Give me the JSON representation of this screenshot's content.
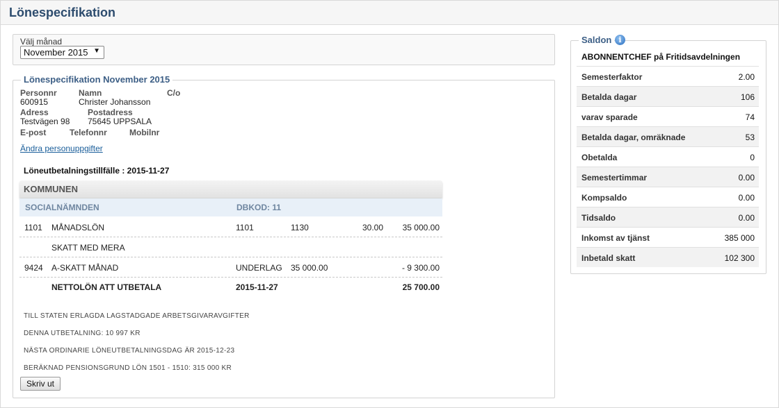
{
  "page": {
    "title": "Lönespecifikation"
  },
  "month": {
    "label": "Välj månad",
    "selected": "November 2015"
  },
  "spec": {
    "legend": "Lönespecifikation November 2015",
    "personnr_label": "Personnr",
    "personnr": "600915",
    "namn_label": "Namn",
    "namn": "Christer Johansson",
    "co_label": "C/o",
    "adress_label": "Adress",
    "adress": "Testvägen 98",
    "postadress_label": "Postadress",
    "postadress": "75645 UPPSALA",
    "epost_label": "E-post",
    "telefon_label": "Telefonnr",
    "mobil_label": "Mobilnr",
    "edit_link": "Ändra personuppgifter",
    "payout_occasion": "Löneutbetalningstillfälle : 2015-11-27",
    "employer": "KOMMUNEN",
    "department": "SOCIALNÄMNDEN",
    "dbkod": "DBKOD: 11",
    "rows": [
      {
        "code": "1101",
        "text": "MÅNADSLÖN",
        "c3": "1101",
        "c4": "1130",
        "c5": "30.00",
        "amount": "35 000.00"
      },
      {
        "code": "",
        "text": "SKATT MED MERA",
        "c3": "",
        "c4": "",
        "c5": "",
        "amount": ""
      },
      {
        "code": "9424",
        "text": "A-SKATT MÅNAD",
        "c3": "UNDERLAG",
        "c4": "35 000.00",
        "c5": "",
        "amount": "- 9 300.00"
      },
      {
        "code": "",
        "text": "NETTOLÖN ATT UTBETALA",
        "c3": "2015-11-27",
        "c4": "",
        "c5": "",
        "amount": "25 700.00"
      }
    ],
    "info": [
      "TILL STATEN ERLAGDA LAGSTADGADE ARBETSGIVARAVGIFTER",
      "DENNA UTBETALNING:  10 997 KR",
      "NÄSTA ORDINARIE LÖNEUTBETALNINGSDAG ÄR   2015-12-23",
      "BERÄKNAD PENSIONSGRUND LÖN   1501 - 1510:  315 000 KR"
    ],
    "print_button": "Skriv ut"
  },
  "saldon": {
    "legend": "Saldon",
    "info_icon": "info-icon",
    "role": "ABONNENTCHEF på Fritidsavdelningen",
    "items": [
      {
        "label": "Semesterfaktor",
        "value": "2.00"
      },
      {
        "label": "Betalda dagar",
        "value": "106"
      },
      {
        "label": "varav sparade",
        "value": "74"
      },
      {
        "label": "Betalda dagar, omräknade",
        "value": "53"
      },
      {
        "label": "Obetalda",
        "value": "0"
      },
      {
        "label": "Semestertimmar",
        "value": "0.00"
      },
      {
        "label": "Kompsaldo",
        "value": "0.00"
      },
      {
        "label": "Tidsaldo",
        "value": "0.00"
      },
      {
        "label": "Inkomst av tjänst",
        "value": "385 000"
      },
      {
        "label": "Inbetald skatt",
        "value": "102 300"
      }
    ]
  }
}
